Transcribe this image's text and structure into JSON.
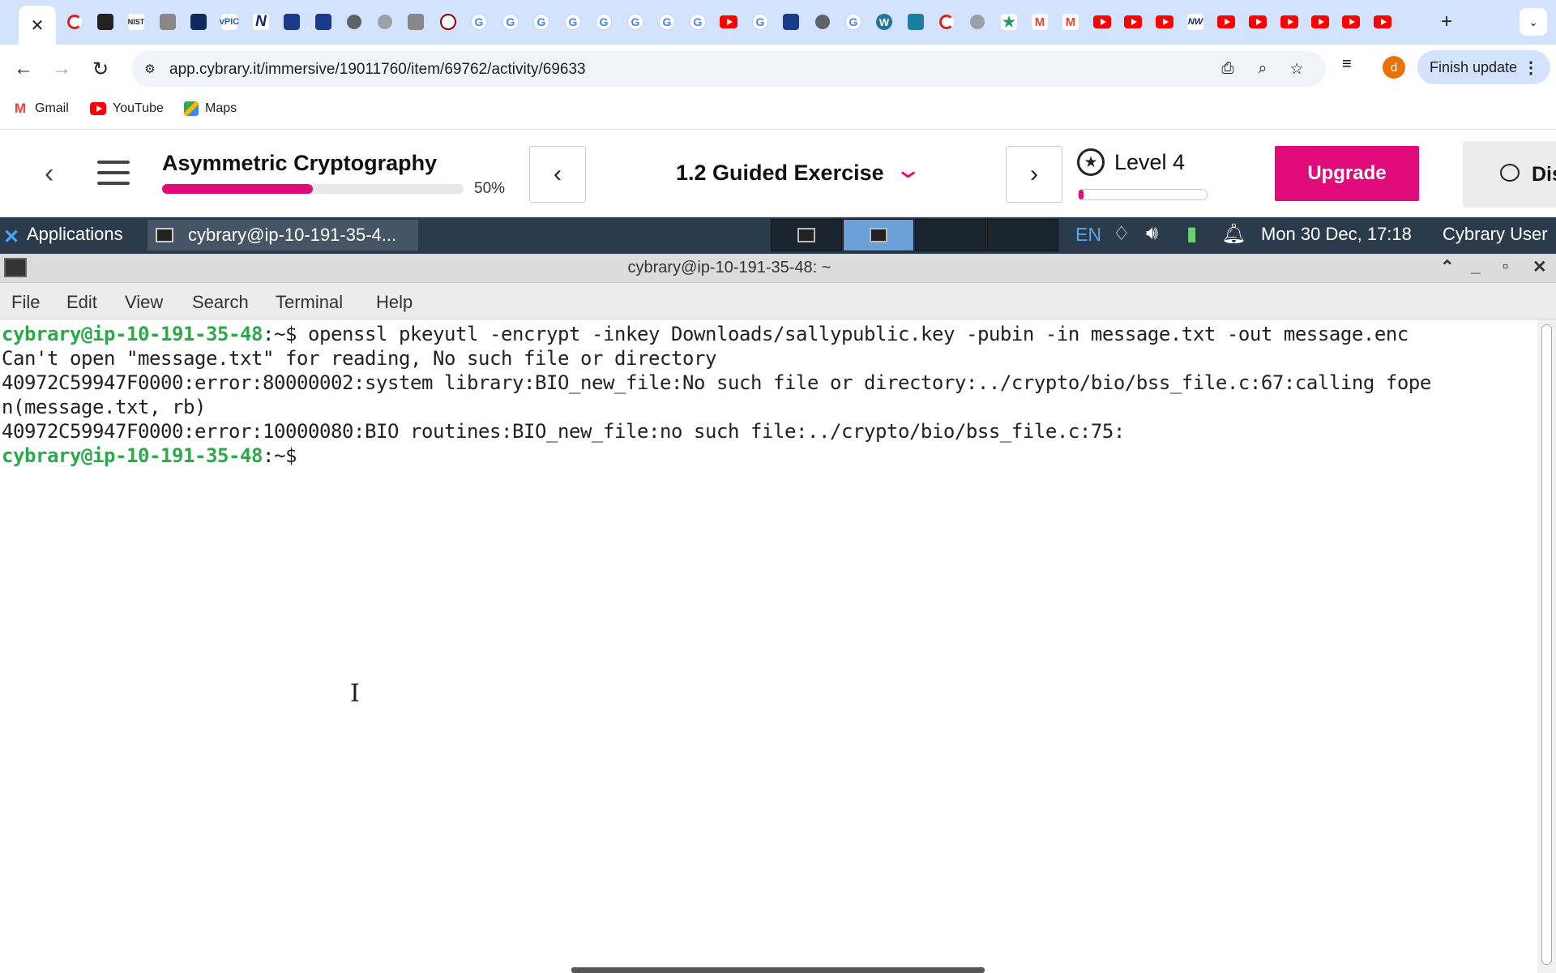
{
  "browser": {
    "tabs": [
      {
        "icon": "close-icon",
        "active": true
      },
      {
        "icon": "spinner-favicon-icon"
      },
      {
        "icon": "terminal-favicon-icon"
      },
      {
        "icon": "nist-favicon-icon",
        "text": "NIST"
      },
      {
        "icon": "seal-favicon-icon"
      },
      {
        "icon": "badge-favicon-icon"
      },
      {
        "icon": "vpic-favicon-icon",
        "text": "vPIC"
      },
      {
        "icon": "n-favicon-icon",
        "text": "N"
      },
      {
        "icon": "bookmark-favicon-icon"
      },
      {
        "icon": "bookmark-favicon-icon"
      },
      {
        "icon": "globe-icon"
      },
      {
        "icon": "globe-light-icon"
      },
      {
        "icon": "avatar-favicon-icon"
      },
      {
        "icon": "wikipedia-favicon-icon"
      },
      {
        "icon": "google-favicon-icon",
        "text": "G"
      },
      {
        "icon": "google-favicon-icon",
        "text": "G"
      },
      {
        "icon": "google-favicon-icon",
        "text": "G"
      },
      {
        "icon": "google-favicon-icon",
        "text": "G"
      },
      {
        "icon": "google-favicon-icon",
        "text": "G"
      },
      {
        "icon": "google-favicon-icon",
        "text": "G"
      },
      {
        "icon": "google-favicon-icon",
        "text": "G"
      },
      {
        "icon": "google-favicon-icon",
        "text": "G"
      },
      {
        "icon": "youtube-favicon-icon"
      },
      {
        "icon": "google-favicon-icon",
        "text": "G"
      },
      {
        "icon": "bookmark-favicon-icon"
      },
      {
        "icon": "globe-icon"
      },
      {
        "icon": "google-favicon-icon",
        "text": "G"
      },
      {
        "icon": "wordpress-favicon-icon",
        "text": "W"
      },
      {
        "icon": "app-favicon-icon"
      },
      {
        "icon": "spinner-red-icon"
      },
      {
        "icon": "globe-light-icon"
      },
      {
        "icon": "star-favicon-icon",
        "text": "★"
      },
      {
        "icon": "gmail-favicon-icon",
        "text": "M"
      },
      {
        "icon": "gmail-favicon-icon",
        "text": "M"
      },
      {
        "icon": "youtube-favicon-icon"
      },
      {
        "icon": "youtube-favicon-icon"
      },
      {
        "icon": "youtube-favicon-icon"
      },
      {
        "icon": "nw-favicon-icon",
        "text": "NW"
      },
      {
        "icon": "youtube-favicon-icon"
      },
      {
        "icon": "youtube-favicon-icon"
      },
      {
        "icon": "youtube-favicon-icon"
      },
      {
        "icon": "youtube-favicon-icon"
      },
      {
        "icon": "youtube-favicon-icon"
      },
      {
        "icon": "youtube-favicon-icon"
      }
    ],
    "new_tab": "+",
    "url": "app.cybrary.it/immersive/19011760/item/69762/activity/69633",
    "profile_initial": "d",
    "finish_update": "Finish update",
    "bookmarks": [
      {
        "label": "Gmail",
        "icon": "gmail-icon"
      },
      {
        "label": "YouTube",
        "icon": "youtube-icon"
      },
      {
        "label": "Maps",
        "icon": "maps-icon"
      }
    ]
  },
  "cybrary": {
    "course_title": "Asymmetric Cryptography",
    "course_progress_pct": 50,
    "course_progress_label": "50%",
    "exercise_title": "1.2 Guided Exercise",
    "level_label": "Level 4",
    "level_progress_pct": 4,
    "upgrade_label": "Upgrade",
    "discuss_label": "Dis"
  },
  "desktop_panel": {
    "applications_label": "Applications",
    "task_label": "cybrary@ip-10-191-35-4...",
    "language": "EN",
    "clock": "Mon 30 Dec, 17:18",
    "user": "Cybrary User"
  },
  "terminal": {
    "title": "cybrary@ip-10-191-35-48: ~",
    "menu": [
      "File",
      "Edit",
      "View",
      "Search",
      "Terminal",
      "Help"
    ],
    "lines": [
      {
        "prompt": "cybrary@ip-10-191-35-48",
        "path": ":~$",
        "text": " openssl pkeyutl -encrypt -inkey Downloads/sallypublic.key -pubin -in message.txt -out message.enc"
      },
      {
        "prompt": "",
        "path": "",
        "text": "Can't open \"message.txt\" for reading, No such file or directory"
      },
      {
        "prompt": "",
        "path": "",
        "text": "40972C59947F0000:error:80000002:system library:BIO_new_file:No such file or directory:../crypto/bio/bss_file.c:67:calling fope"
      },
      {
        "prompt": "",
        "path": "",
        "text": "n(message.txt, rb)"
      },
      {
        "prompt": "",
        "path": "",
        "text": "40972C59947F0000:error:10000080:BIO routines:BIO_new_file:no such file:../crypto/bio/bss_file.c:75:"
      },
      {
        "prompt": "cybrary@ip-10-191-35-48",
        "path": ":~$",
        "text": ""
      }
    ]
  }
}
